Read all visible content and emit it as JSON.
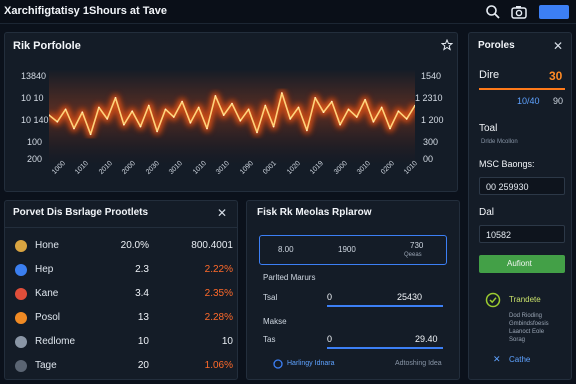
{
  "app": {
    "title": "Xarchifigtatisy 1Shours at Tave",
    "button": ""
  },
  "main_chart": {
    "title": "Rik Porfolole",
    "y_left_ticks": [
      "13840",
      "10 10",
      "10 140",
      "100",
      "200"
    ],
    "y_right_ticks": [
      "1540",
      "1 2310",
      "1 200",
      "300",
      "00"
    ],
    "x_ticks": [
      "1000",
      "1010",
      "2010",
      "2000",
      "2030",
      "3010",
      "1010",
      "3010",
      "1090",
      "0001",
      "1020",
      "1019",
      "3000",
      "3010",
      "0200",
      "1010"
    ]
  },
  "chart_data": {
    "type": "line",
    "title": "Rik Porfolole",
    "xlabel": "",
    "ylabel": "",
    "ylim": [
      0,
      1
    ],
    "grid": false,
    "series": [
      {
        "values": [
          0.52,
          0.45,
          0.58,
          0.38,
          0.55,
          0.32,
          0.6,
          0.48,
          0.7,
          0.42,
          0.56,
          0.4,
          0.62,
          0.35,
          0.58,
          0.5,
          0.66,
          0.44,
          0.6,
          0.38,
          0.72,
          0.52,
          0.64,
          0.46,
          0.58,
          0.34,
          0.62,
          0.4,
          0.75,
          0.48,
          0.6,
          0.36,
          0.7,
          0.55,
          0.66,
          0.42,
          0.58,
          0.5,
          0.68,
          0.45,
          0.6,
          0.38,
          0.56,
          0.48,
          0.62
        ]
      }
    ]
  },
  "bottom_left": {
    "title": "Porvet Dis Bsrlage Prootlets",
    "rows": [
      {
        "label": "Hone",
        "c2": "20.0%",
        "c3": "800.4001",
        "c3_color": "#e8edf3",
        "icon_color": "#d9a441"
      },
      {
        "label": "Hep",
        "c2": "2.3",
        "c3": "2.22%",
        "c3_color": "#ff6a2a",
        "icon_color": "#3b7ff0"
      },
      {
        "label": "Kane",
        "c2": "3.4",
        "c3": "2.35%",
        "c3_color": "#ff6a2a",
        "icon_color": "#e04e3a"
      },
      {
        "label": "Posol",
        "c2": "13",
        "c3": "2.28%",
        "c3_color": "#ff6a2a",
        "icon_color": "#f08a24"
      },
      {
        "label": "Redlome",
        "c2": "10",
        "c3": "10",
        "c3_color": "#e8edf3",
        "icon_color": "#8a96a6"
      },
      {
        "label": "Tage",
        "c2": "20",
        "c3": "1.06%",
        "c3_color": "#ff6a2a",
        "icon_color": "#5b6573"
      }
    ]
  },
  "bottom_mid": {
    "title": "Fisk Rk Meolas Rplarow",
    "box": [
      "8.00",
      "1900",
      "730"
    ],
    "box_sub": "Qeeas",
    "pending_label": "Parlted Marurs",
    "r1_label": "Tsal",
    "r1_left": "0",
    "r1_right": "25430",
    "makes_label": "Makse",
    "r2_label": "Tas",
    "r2_left": "0",
    "r2_right": "29.40",
    "foot_left": "Harlingy Idnara",
    "foot_right": "Adtoshing Idea"
  },
  "right": {
    "title": "Poroles",
    "dire_label": "Dire",
    "dire_value": "30",
    "dire_row2_a": "10/40",
    "dire_row2_b": "90",
    "toal_label": "Toal",
    "toal_sub": "Drlde Mcollon",
    "msc_label": "MSC Baongs:",
    "msc_value": "00 259930",
    "dal_label": "Dal",
    "dal_value": "10582",
    "action": "Aufiont",
    "status_title": "Trandete",
    "status_lines": [
      "Dod Rioding",
      "Gmbindsfoesis",
      "Laanoct Eole",
      "Sorag"
    ],
    "cancel": "Cathe"
  },
  "colors": {
    "accent": "#3c7ff5",
    "orange": "#ff6a2a",
    "green": "#4caf50",
    "panel": "#141c27"
  }
}
